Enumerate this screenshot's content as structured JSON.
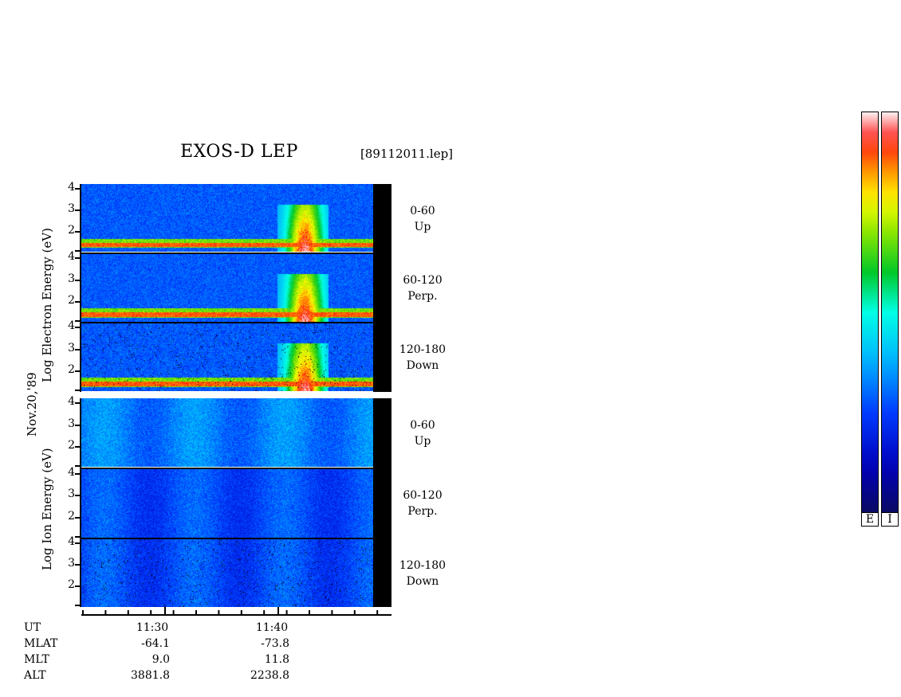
{
  "chart_data": {
    "type": "heatmap",
    "title": "EXOS-D LEP",
    "file_label": "[89112011.lep]",
    "date_label": "Nov.20,'89",
    "electron_ylabel": "Log  Electron  Energy (eV)",
    "ion_ylabel": "Log  Ion  Energy (eV)",
    "y_ticks": [
      "4",
      "3",
      "2"
    ],
    "ylim": [
      1,
      4.2
    ],
    "panels": [
      {
        "group": "electron",
        "channel_range": "0-60",
        "channel_dir": "Up"
      },
      {
        "group": "electron",
        "channel_range": "60-120",
        "channel_dir": "Perp."
      },
      {
        "group": "electron",
        "channel_range": "120-180",
        "channel_dir": "Down"
      },
      {
        "group": "ion",
        "channel_range": "0-60",
        "channel_dir": "Up"
      },
      {
        "group": "ion",
        "channel_range": "60-120",
        "channel_dir": "Perp."
      },
      {
        "group": "ion",
        "channel_range": "120-180",
        "channel_dir": "Down"
      }
    ],
    "x_axis": {
      "rows": [
        {
          "name": "UT",
          "values": [
            "11:30",
            "11:40"
          ]
        },
        {
          "name": "MLAT",
          "values": [
            "-64.1",
            "-73.8"
          ]
        },
        {
          "name": "MLT",
          "values": [
            "9.0",
            "11.8"
          ]
        },
        {
          "name": "ALT",
          "values": [
            "3881.8",
            "2238.8"
          ]
        }
      ]
    },
    "colorbars": [
      {
        "label": "E"
      },
      {
        "label": "I"
      }
    ]
  }
}
